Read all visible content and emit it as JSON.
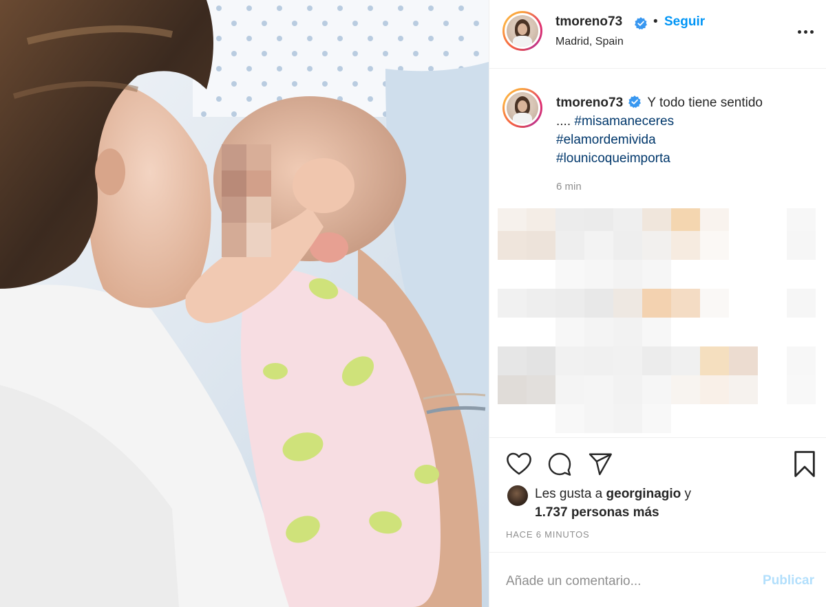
{
  "post": {
    "username": "tmoreno73",
    "verified": true,
    "follow_separator": "•",
    "follow_label": "Seguir",
    "location": "Madrid, Spain",
    "more_icon": "more-options-icon"
  },
  "caption": {
    "username": "tmoreno73",
    "text": "Y todo tiene sentido",
    "ellipsis": "....",
    "hashtags": [
      "#misamaneceres",
      "#elamordemivida",
      "#lounicoqueimporta"
    ],
    "time_ago": "6 min"
  },
  "actions": {
    "icons": [
      "heart-icon",
      "comment-icon",
      "share-icon",
      "bookmark-icon"
    ]
  },
  "likes": {
    "prefix": "Les gusta a",
    "liker": "georginagio",
    "connector": "y",
    "count_text": "1.737 personas más"
  },
  "posted_when": "HACE 6 MINUTOS",
  "comment": {
    "placeholder": "Añade un comentario...",
    "publish_label": "Publicar"
  },
  "colors": {
    "link_blue": "#0095f6",
    "hashtag_blue": "#00376b",
    "publish_disabled": "#b2dffc",
    "text": "#262626",
    "secondary": "#8e8e8e"
  }
}
